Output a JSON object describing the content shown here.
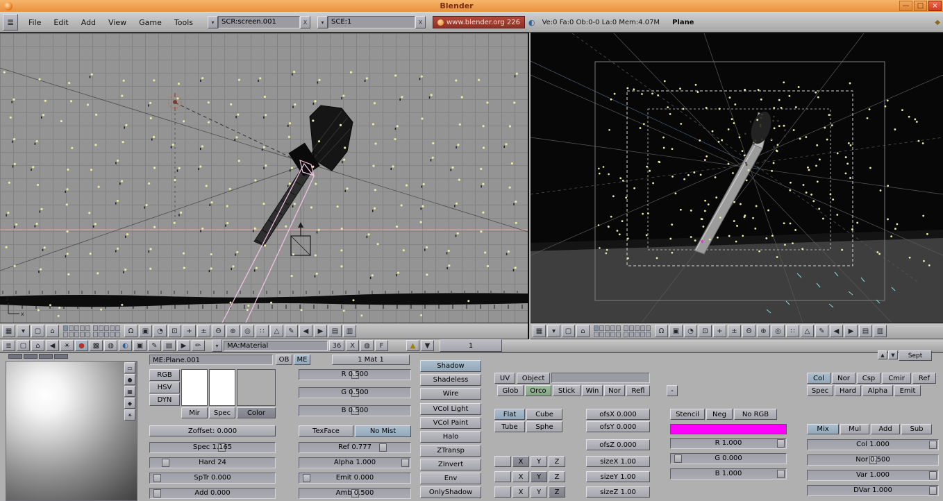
{
  "window": {
    "title": "Blender",
    "minimize": "—",
    "maximize": "□",
    "close": "×"
  },
  "topbar": {
    "menus": [
      "File",
      "Edit",
      "Add",
      "View",
      "Game",
      "Tools"
    ],
    "browse_glyph": "▾",
    "screen_value": "SCR:screen.001",
    "scene_value": "SCE:1",
    "close_x": "X",
    "site": "www.blender.org 226",
    "stats": "Ve:0 Fa:0 Ob:0-0 La:0 Mem:4.07M",
    "active_object": "Plane",
    "icons": {
      "window_type": "≣",
      "world": "◐",
      "right": "◆"
    }
  },
  "viewport_header_icons": [
    {
      "name": "editor-type-icon",
      "glyph": "▦"
    },
    {
      "name": "header-menu-icon",
      "glyph": "▾"
    },
    {
      "name": "fullscreen-icon",
      "glyph": "▢"
    },
    {
      "name": "home-icon",
      "glyph": "⌂"
    },
    {
      "name": "layers-widget",
      "glyph": ""
    },
    {
      "name": "lock-icon",
      "glyph": "Ω"
    },
    {
      "name": "mode-icon",
      "glyph": "▣"
    },
    {
      "name": "shading-icon",
      "glyph": "◔"
    },
    {
      "name": "pivot-icon",
      "glyph": "⊡"
    },
    {
      "name": "manipulator-move-icon",
      "glyph": "+"
    },
    {
      "name": "manipulator-scale-icon",
      "glyph": "±"
    },
    {
      "name": "manipulator-rotate-icon",
      "glyph": "Θ"
    },
    {
      "name": "snap-icon",
      "glyph": "⊕"
    },
    {
      "name": "proportional-icon",
      "glyph": "◎"
    },
    {
      "name": "particle-select-icon",
      "glyph": "∷"
    },
    {
      "name": "face-select-icon",
      "glyph": "△"
    },
    {
      "name": "draw-icon",
      "glyph": "✎"
    },
    {
      "name": "step-back-icon",
      "glyph": "◀"
    },
    {
      "name": "step-forward-icon",
      "glyph": "▶"
    },
    {
      "name": "render-preview-icon",
      "glyph": "▤"
    },
    {
      "name": "image-icon",
      "glyph": "▥"
    }
  ],
  "buttons_header": {
    "icons": [
      {
        "name": "editor-type-icon",
        "glyph": "≣"
      },
      {
        "name": "fullscreen-icon",
        "glyph": "▢"
      },
      {
        "name": "home-icon",
        "glyph": "⌂"
      },
      {
        "name": "back-icon",
        "glyph": "◀"
      },
      {
        "name": "lamp-icon",
        "glyph": "☀"
      },
      {
        "name": "material-icon",
        "glyph": "●",
        "color": "#b23326",
        "on": true
      },
      {
        "name": "texture-icon",
        "glyph": "▩"
      },
      {
        "name": "radiosity-icon",
        "glyph": "◍"
      },
      {
        "name": "world-icon",
        "glyph": "◐",
        "color": "#2e5f9e"
      },
      {
        "name": "object-icon",
        "glyph": "▣"
      },
      {
        "name": "edit-icon",
        "glyph": "✎"
      },
      {
        "name": "scene-icon",
        "glyph": "▤"
      },
      {
        "name": "anim-icon",
        "glyph": "▶"
      },
      {
        "name": "script-icon",
        "glyph": "✏"
      }
    ],
    "browse_glyph": "▾",
    "material_field": "MA:Material",
    "users": "36",
    "delete_x": "X",
    "auto_glyph": "◍",
    "fake_user": "F",
    "up": "▲",
    "down": "▼",
    "frame": "1",
    "side_tab": {
      "up": "▲",
      "down": "▼",
      "label": "Sept"
    }
  },
  "preview": {
    "icons": [
      {
        "name": "preview-flat-icon",
        "glyph": "▭"
      },
      {
        "name": "preview-sphere-icon",
        "glyph": "●"
      },
      {
        "name": "preview-cube-icon",
        "glyph": "▦"
      },
      {
        "name": "preview-monkey-icon",
        "glyph": "◆"
      },
      {
        "name": "preview-sky-icon",
        "glyph": "☀"
      }
    ]
  },
  "panels": {
    "links": {
      "mesh": "ME:Plane.001",
      "ob": "OB",
      "me": "ME",
      "mat": "1 Mat 1"
    },
    "material": {
      "modes": [
        "RGB",
        "HSV",
        "DYN"
      ],
      "swatches": [
        "#ffffff",
        "#ffffff",
        "#aeaeae"
      ],
      "swatch_buttons": [
        "Mir",
        "Spec",
        "Color"
      ],
      "zoffset": "Zoffset: 0.000",
      "sliders": [
        {
          "t": "Spec 1.165",
          "f": 0.58
        },
        {
          "t": "Hard 24",
          "f": 0.09
        },
        {
          "t": "SpTr 0.000",
          "f": 0.02
        },
        {
          "t": "Add 0.000",
          "f": 0.02
        }
      ],
      "rgb": [
        {
          "t": "R 0.500",
          "f": 0.5
        },
        {
          "t": "G 0.500",
          "f": 0.5
        },
        {
          "t": "B 0.500",
          "f": 0.5
        }
      ],
      "texface": "TexFace",
      "no_mist": "No Mist",
      "sliders2": [
        {
          "t": "Ref 0.777",
          "f": 0.78
        },
        {
          "t": "Alpha 1.000",
          "f": 1
        },
        {
          "t": "Emit 0.000",
          "f": 0.02
        },
        {
          "t": "Amb 0.500",
          "f": 0.5
        }
      ]
    },
    "shaders": {
      "toggles": [
        "Shadow",
        "Shadeless",
        "Wire",
        "VCol Light",
        "VCol Paint",
        "Halo",
        "ZTransp",
        "ZInvert",
        "Env",
        "OnlyShadow"
      ],
      "active": "Shadow"
    },
    "map_input": {
      "uv": "UV",
      "object": "Object",
      "object_name": "",
      "coords": [
        "Glob",
        "Orco",
        "Stick",
        "Win",
        "Nor",
        "Refl"
      ],
      "active_coord": "Orco",
      "proj": [
        "Flat",
        "Cube",
        "Tube",
        "Sphe"
      ],
      "active_proj": "Flat",
      "ofs": [
        "ofsX 0.000",
        "ofsY 0.000",
        "ofsZ 0.000"
      ],
      "size": [
        "sizeX 1.00",
        "sizeY 1.00",
        "sizeZ 1.00"
      ],
      "axis": [
        "X",
        "Y",
        "Z"
      ],
      "channel_menu": "-"
    },
    "map_to": {
      "targets_row1": [
        "Col",
        "Nor",
        "Csp",
        "Cmir",
        "Ref"
      ],
      "targets_row2": [
        "Spec",
        "Hard",
        "Alpha",
        "Emit"
      ],
      "active_target": "Col",
      "stencil": [
        "Stencil",
        "Neg",
        "No RGB"
      ],
      "swatch_color": "#ff00ff",
      "rgb": [
        {
          "t": "R 1.000",
          "f": 1
        },
        {
          "t": "G 0.000",
          "f": 0.02
        },
        {
          "t": "B 1.000",
          "f": 1
        }
      ],
      "blend": [
        "Mix",
        "Mul",
        "Add",
        "Sub"
      ],
      "active_blend": "Mix",
      "amounts": [
        {
          "t": "Col 1.000",
          "f": 1
        },
        {
          "t": "Nor 0.500",
          "f": 0.5
        },
        {
          "t": "Var 1.000",
          "f": 1
        },
        {
          "t": "DVar 1.000",
          "f": 1
        }
      ]
    }
  },
  "colors": {
    "particle": "#e9e9a8",
    "selection_pink": "#f2c2e0",
    "axis_pink": "#d8a0a0",
    "magenta": "#ff00ff",
    "cyan_tick": "#8adadd",
    "titlebar": "#ef9d4a",
    "site_red": "#a33c32"
  }
}
